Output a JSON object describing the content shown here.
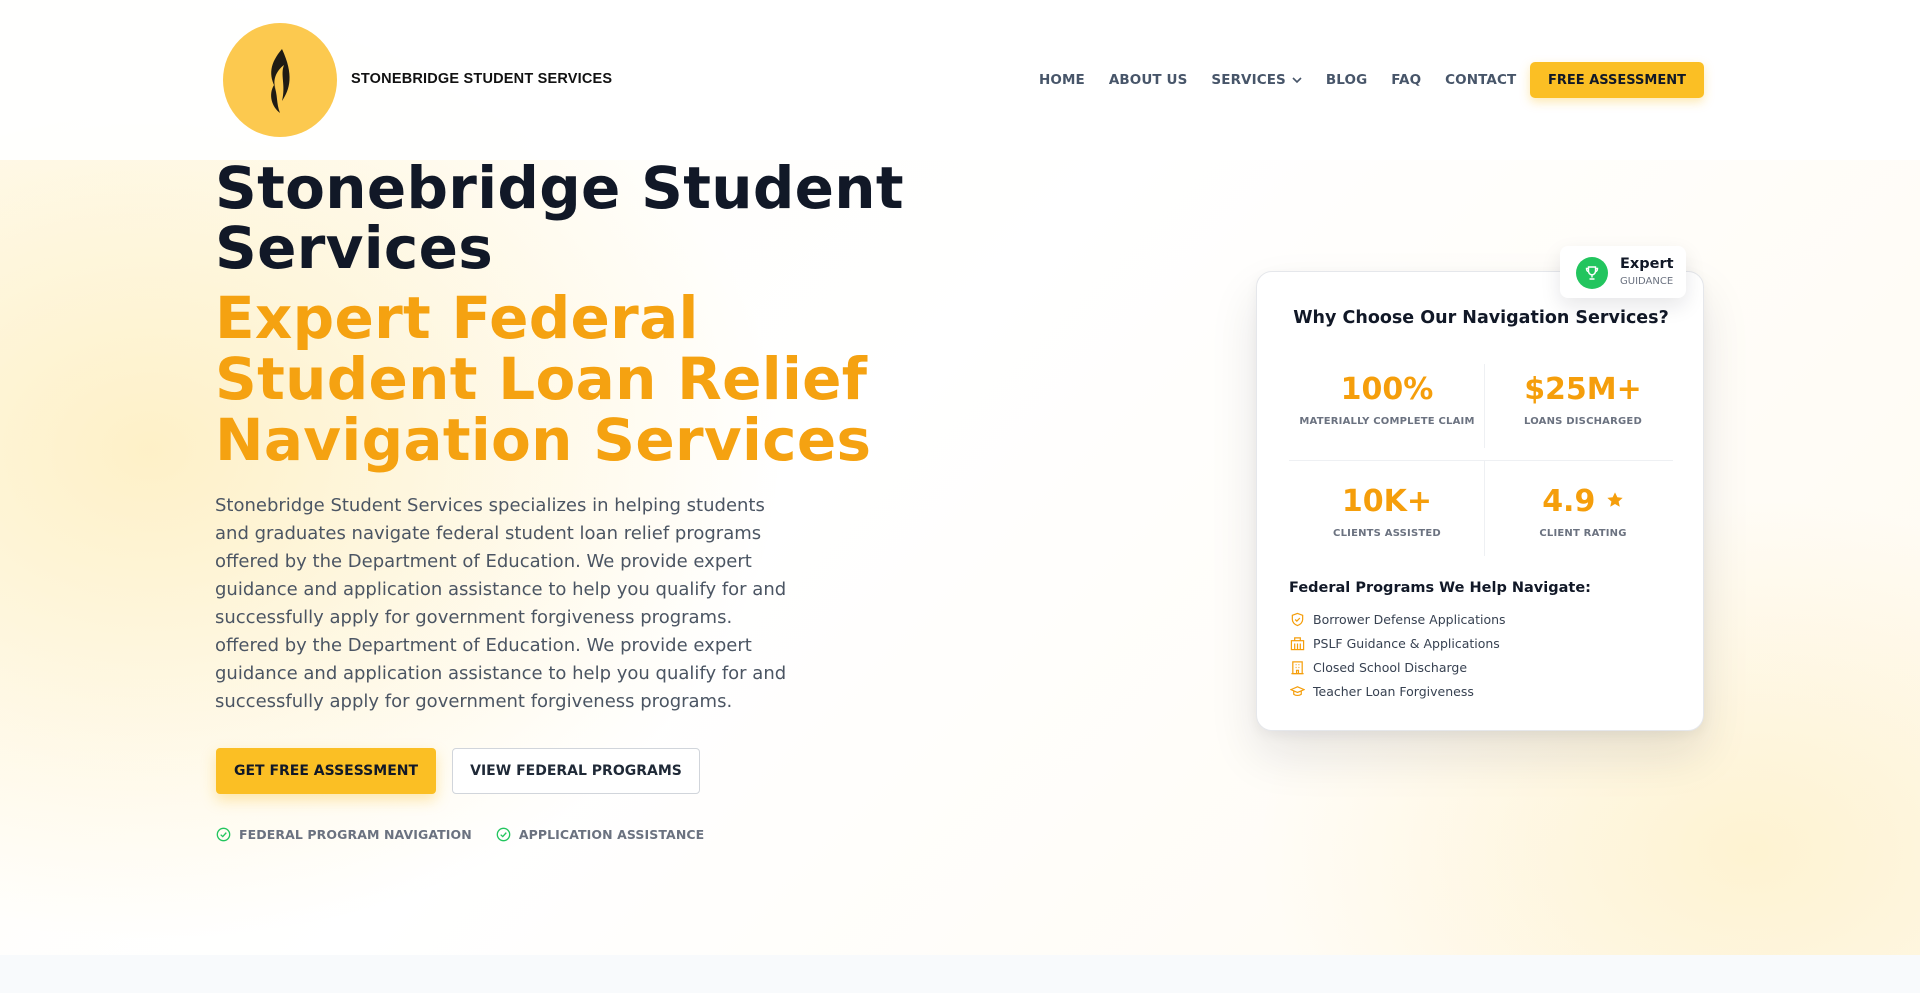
{
  "brand": {
    "name": "STONEBRIDGE STUDENT SERVICES",
    "logo_color": "#fcc94f"
  },
  "nav": {
    "items": [
      "HOME",
      "ABOUT US",
      "SERVICES",
      "BLOG",
      "FAQ",
      "CONTACT"
    ],
    "cta_label": "FREE ASSESSMENT"
  },
  "hero": {
    "title": "Stonebridge Student Services",
    "subtitle": "Expert Federal Student Loan Relief Navigation Services",
    "description": "Stonebridge Student Services specializes in helping students and graduates navigate federal student loan relief programs offered by the Department of Education. We provide expert guidance and application assistance to help you qualify for and successfully apply for government forgiveness programs. offered by the Department of Education. We provide expert guidance and application assistance to help you qualify for and successfully apply for government forgiveness programs.",
    "primary_button": "GET FREE ASSESSMENT",
    "secondary_button": "VIEW FEDERAL PROGRAMS",
    "badges": [
      "FEDERAL PROGRAM NAVIGATION",
      "APPLICATION ASSISTANCE"
    ]
  },
  "card": {
    "title": "Why Choose Our Navigation Services?",
    "stats": [
      {
        "value": "100%",
        "label": "MATERIALLY COMPLETE CLAIM"
      },
      {
        "value": "$25M+",
        "label": "LOANS DISCHARGED"
      },
      {
        "value": "10K+",
        "label": "CLIENTS ASSISTED"
      },
      {
        "value": "4.9",
        "label": "CLIENT RATING"
      }
    ],
    "programs_title": "Federal Programs We Help Navigate:",
    "programs": [
      {
        "label": "Borrower Defense Applications",
        "icon": "shield-icon"
      },
      {
        "label": "PSLF Guidance & Applications",
        "icon": "building-icon"
      },
      {
        "label": "Closed School Discharge",
        "icon": "school-icon"
      },
      {
        "label": "Teacher Loan Forgiveness",
        "icon": "graduation-cap-icon"
      }
    ]
  },
  "float_badge": {
    "title": "Expert",
    "subtitle": "GUIDANCE",
    "icon": "trophy-icon"
  },
  "colors": {
    "accent": "#fbbf24",
    "accent_text": "#f5a211",
    "success": "#22c55e"
  }
}
